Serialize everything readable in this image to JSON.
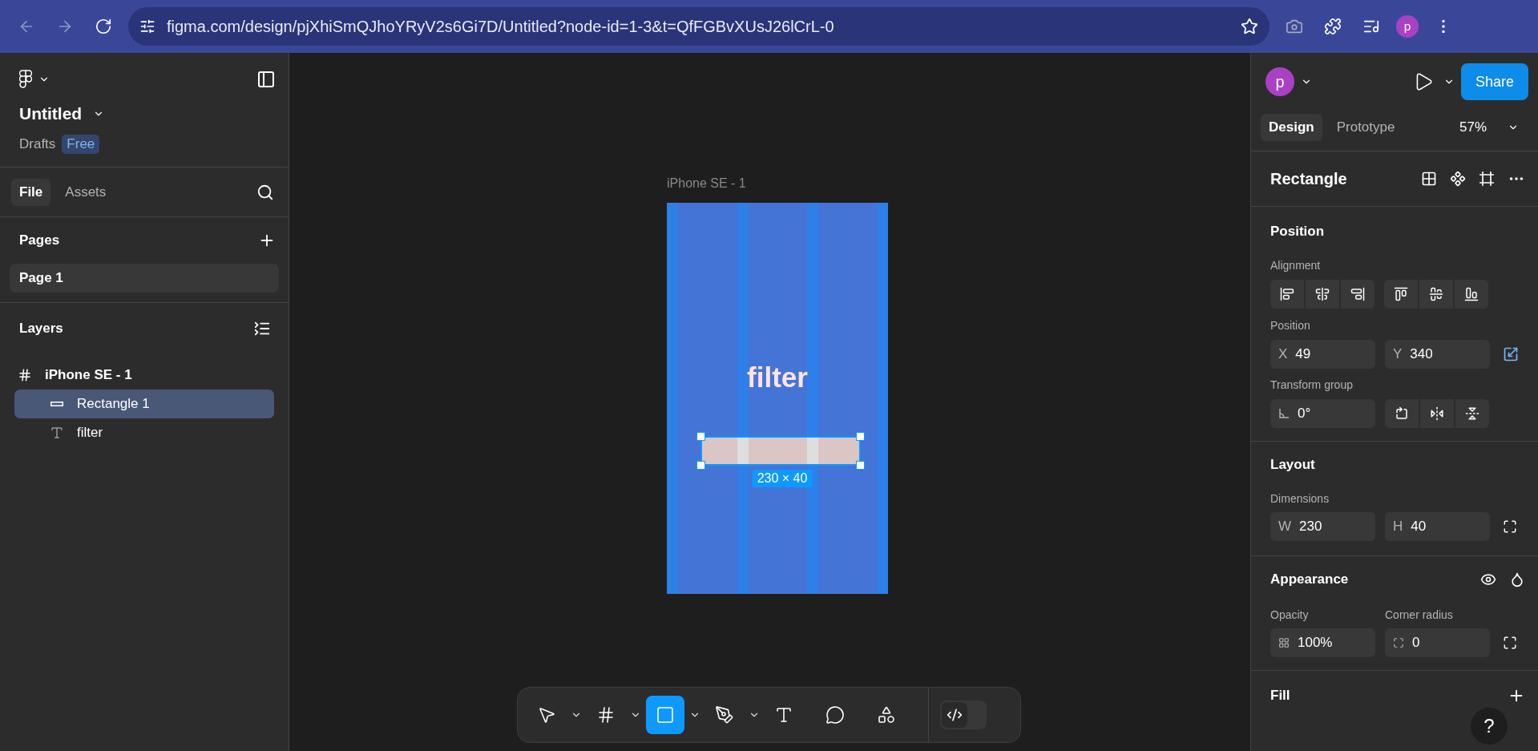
{
  "browser": {
    "url": "figma.com/design/pjXhiSmQJhoYRyV2s6Gi7D/Untitled?node-id=1-3&t=QfFGBvXUsJ26lCrL-0",
    "profile": "p"
  },
  "left_panel": {
    "file_title": "Untitled",
    "location": "Drafts",
    "plan_badge": "Free",
    "tabs": [
      {
        "label": "File",
        "selected": true
      },
      {
        "label": "Assets",
        "selected": false
      }
    ],
    "pages": {
      "title": "Pages",
      "items": [
        {
          "label": "Page 1",
          "selected": true
        }
      ]
    },
    "layers": {
      "title": "Layers",
      "items": [
        {
          "label": "iPhone SE - 1",
          "kind": "frame",
          "selected": false,
          "children": [
            {
              "label": "Rectangle 1",
              "kind": "rectangle",
              "selected": true
            },
            {
              "label": "filter",
              "kind": "text",
              "selected": false
            }
          ]
        }
      ]
    }
  },
  "canvas": {
    "frame_label": "iPhone SE - 1",
    "frame_text": "filter",
    "size_label": "230 × 40"
  },
  "toolbar": {
    "tools": [
      {
        "kind": "move",
        "selected": false,
        "dropdown": true
      },
      {
        "kind": "frame",
        "selected": false,
        "dropdown": true
      },
      {
        "kind": "rectangle",
        "selected": true,
        "dropdown": true
      },
      {
        "kind": "pen",
        "selected": false,
        "dropdown": true
      },
      {
        "kind": "text",
        "selected": false,
        "dropdown": false
      },
      {
        "kind": "comment",
        "selected": false,
        "dropdown": false
      },
      {
        "kind": "actions",
        "selected": false,
        "dropdown": false
      }
    ],
    "dev_mode": {
      "on": false
    }
  },
  "right_panel": {
    "avatar": "p",
    "share": "Share",
    "tabs": [
      {
        "label": "Design",
        "selected": true
      },
      {
        "label": "Prototype",
        "selected": false
      }
    ],
    "zoom": "57%",
    "selection_title": "Rectangle",
    "position": {
      "title": "Position",
      "alignment_label": "Alignment",
      "position_label": "Position",
      "x": {
        "label": "X",
        "value": "49"
      },
      "y": {
        "label": "Y",
        "value": "340"
      },
      "transform_label": "Transform group",
      "rotation": "0°"
    },
    "layout": {
      "title": "Layout",
      "dimensions_label": "Dimensions",
      "w": {
        "label": "W",
        "value": "230"
      },
      "h": {
        "label": "H",
        "value": "40"
      }
    },
    "appearance": {
      "title": "Appearance",
      "opacity_label": "Opacity",
      "opacity": "100%",
      "corner_label": "Corner radius",
      "corner": "0"
    },
    "fill": {
      "title": "Fill"
    },
    "help": "?"
  }
}
